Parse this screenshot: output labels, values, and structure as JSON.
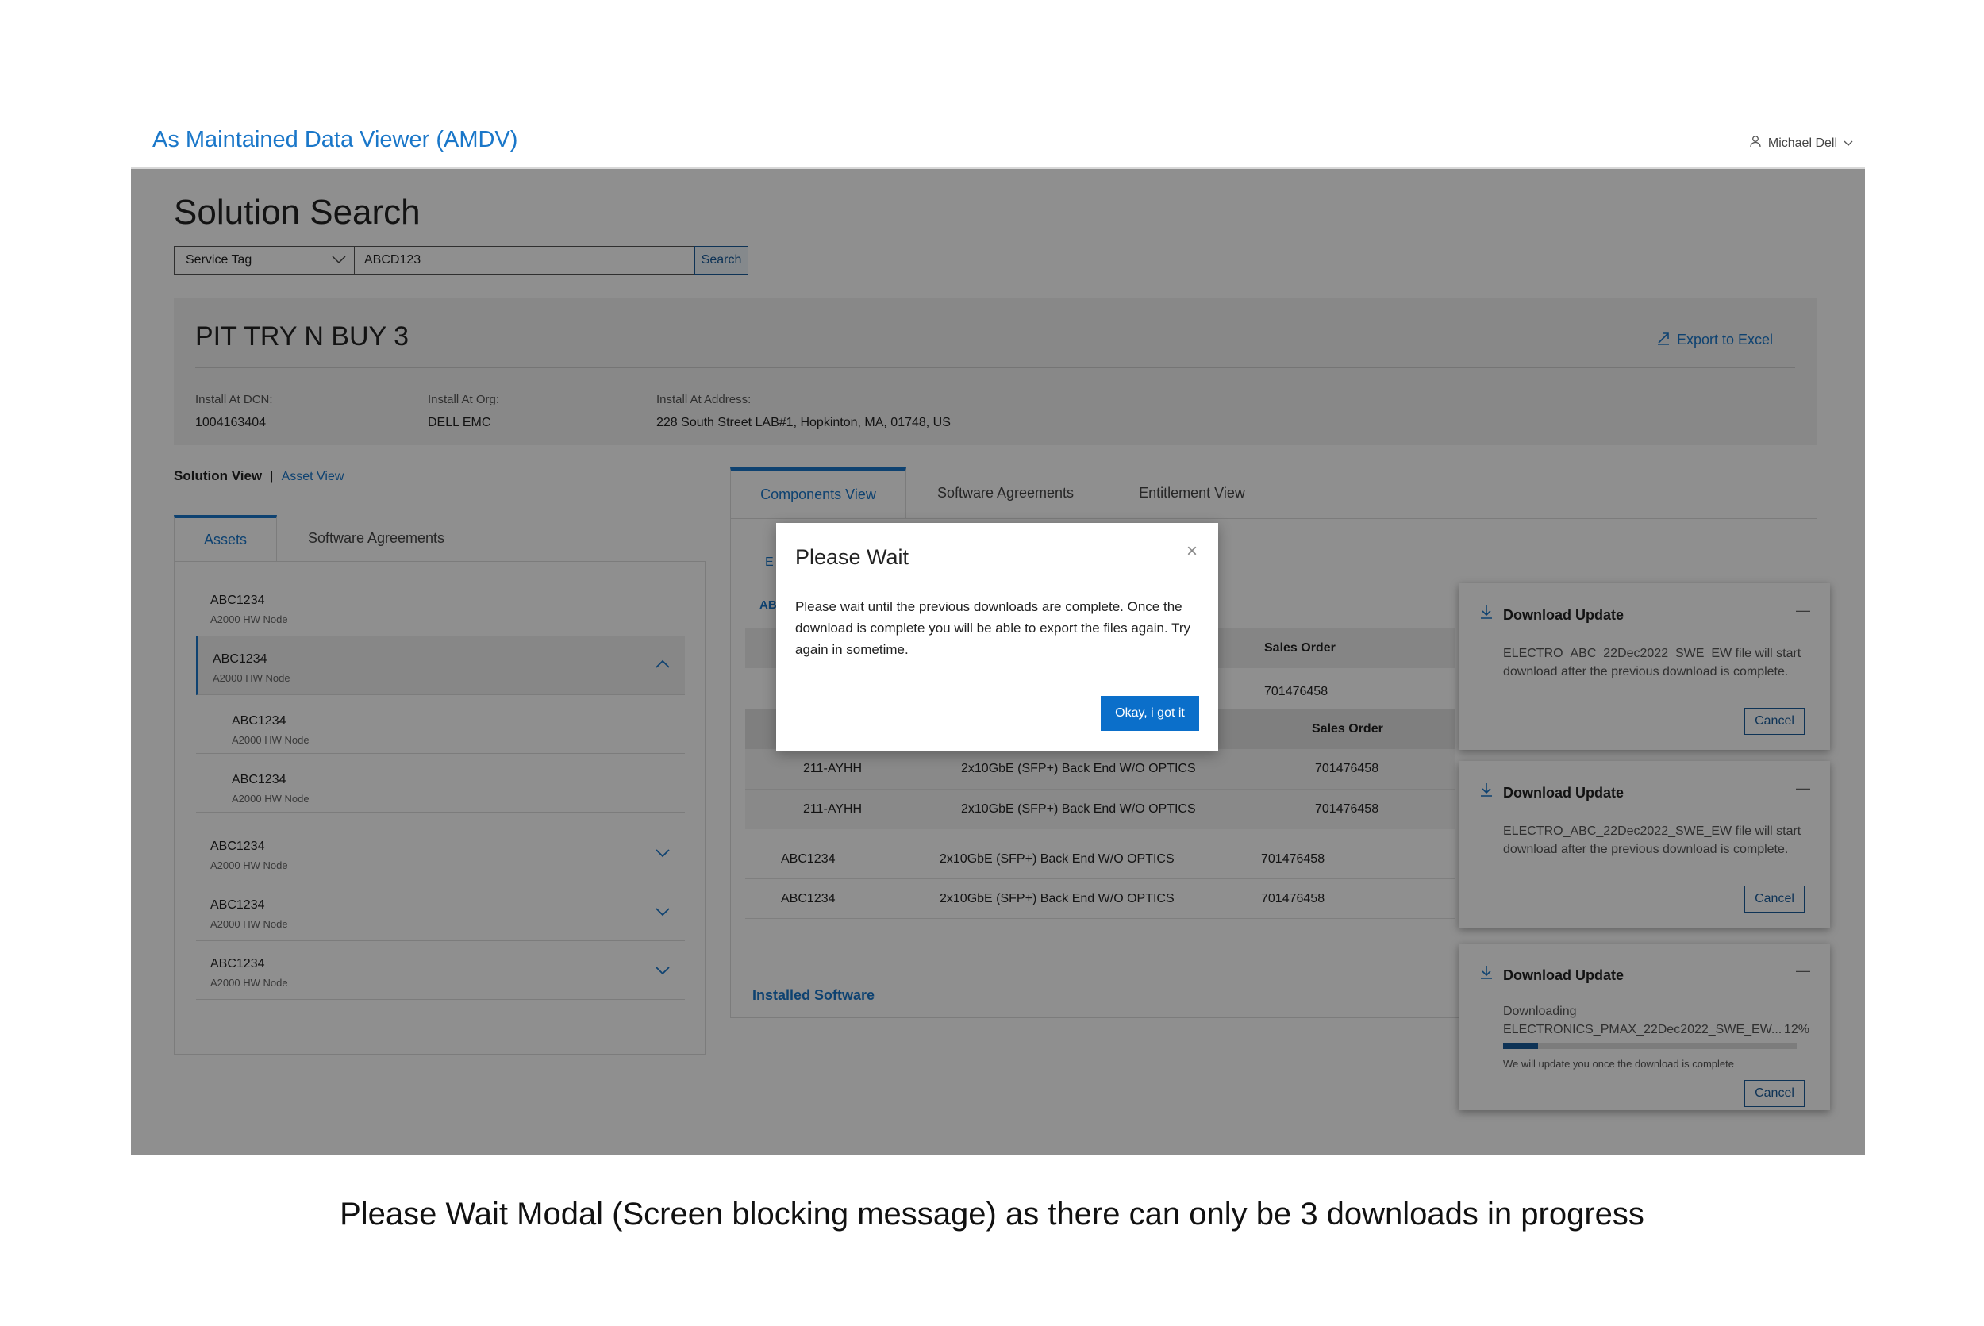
{
  "app": {
    "title": "As Maintained Data Viewer (AMDV)",
    "user": "Michael Dell"
  },
  "search": {
    "heading": "Solution Search",
    "type": "Service Tag",
    "value": "ABCD123",
    "button": "Search"
  },
  "summary": {
    "title": "PIT TRY N BUY 3",
    "export": "Export to Excel",
    "fields": [
      {
        "label": "Install At DCN:",
        "value": "1004163404"
      },
      {
        "label": "Install At Org:",
        "value": "DELL EMC"
      },
      {
        "label": "Install At Address:",
        "value": "228 South Street LAB#1, Hopkinton, MA, 01748, US"
      }
    ]
  },
  "view_switch": {
    "current": "Solution View",
    "separator": "|",
    "alternate": "Asset View"
  },
  "left_tabs": [
    "Assets",
    "Software Agreements"
  ],
  "assets": [
    {
      "title": "ABC1234",
      "subtitle": "A2000 HW Node"
    },
    {
      "title": "ABC1234",
      "subtitle": "A2000 HW Node"
    },
    {
      "title": "ABC1234",
      "subtitle": "A2000 HW Node"
    },
    {
      "title": "ABC1234",
      "subtitle": "A2000 HW Node"
    },
    {
      "title": "ABC1234",
      "subtitle": "A2000 HW Node"
    },
    {
      "title": "ABC1234",
      "subtitle": "A2000 HW Node"
    },
    {
      "title": "ABC1234",
      "subtitle": "A2000 HW Node"
    }
  ],
  "right_tabs": [
    "Components View",
    "Software Agreements",
    "Entitlement View"
  ],
  "components": {
    "partial_left": [
      "E",
      "AB"
    ],
    "header_sales_order": "Sales Order",
    "first_value": "701476458",
    "sub_header": "Sales Order",
    "sub_rows": [
      {
        "part": "211-AYHH",
        "desc": "2x10GbE (SFP+) Back End W/O OPTICS",
        "order": "701476458"
      },
      {
        "part": "211-AYHH",
        "desc": "2x10GbE (SFP+) Back End W/O OPTICS",
        "order": "701476458"
      }
    ],
    "rows": [
      {
        "part": "ABC1234",
        "desc": "2x10GbE (SFP+) Back End W/O OPTICS",
        "order": "701476458"
      },
      {
        "part": "ABC1234",
        "desc": "2x10GbE (SFP+) Back End W/O OPTICS",
        "order": "701476458"
      }
    ],
    "installed_software": "Installed Software"
  },
  "toasts": [
    {
      "title": "Download Update",
      "minimize": "—",
      "body": "ELECTRO_ABC_22Dec2022_SWE_EW file will start download after the previous download is complete.",
      "cancel": "Cancel"
    },
    {
      "title": "Download Update",
      "minimize": "—",
      "body": "ELECTRO_ABC_22Dec2022_SWE_EW file will start download after the previous download is complete.",
      "cancel": "Cancel"
    },
    {
      "title": "Download Update",
      "minimize": "—",
      "status": "Downloading",
      "file": "ELECTRONICS_PMAX_22Dec2022_SWE_EW...",
      "percent": "12%",
      "progress": 0.12,
      "note": "We will update you once the download is complete",
      "cancel": "Cancel"
    }
  ],
  "modal": {
    "title": "Please Wait",
    "close": "×",
    "body": "Please wait until the previous downloads are complete. Once the download is complete you will be able to export the files again. Try again in sometime.",
    "button": "Okay, i got it"
  },
  "caption": "Please Wait Modal (Screen blocking message) as there can only be 3 downloads in progress",
  "colors": {
    "accent": "#1a77c9",
    "button": "#0b6fca",
    "overlay": "rgba(0,0,0,0.44)"
  }
}
